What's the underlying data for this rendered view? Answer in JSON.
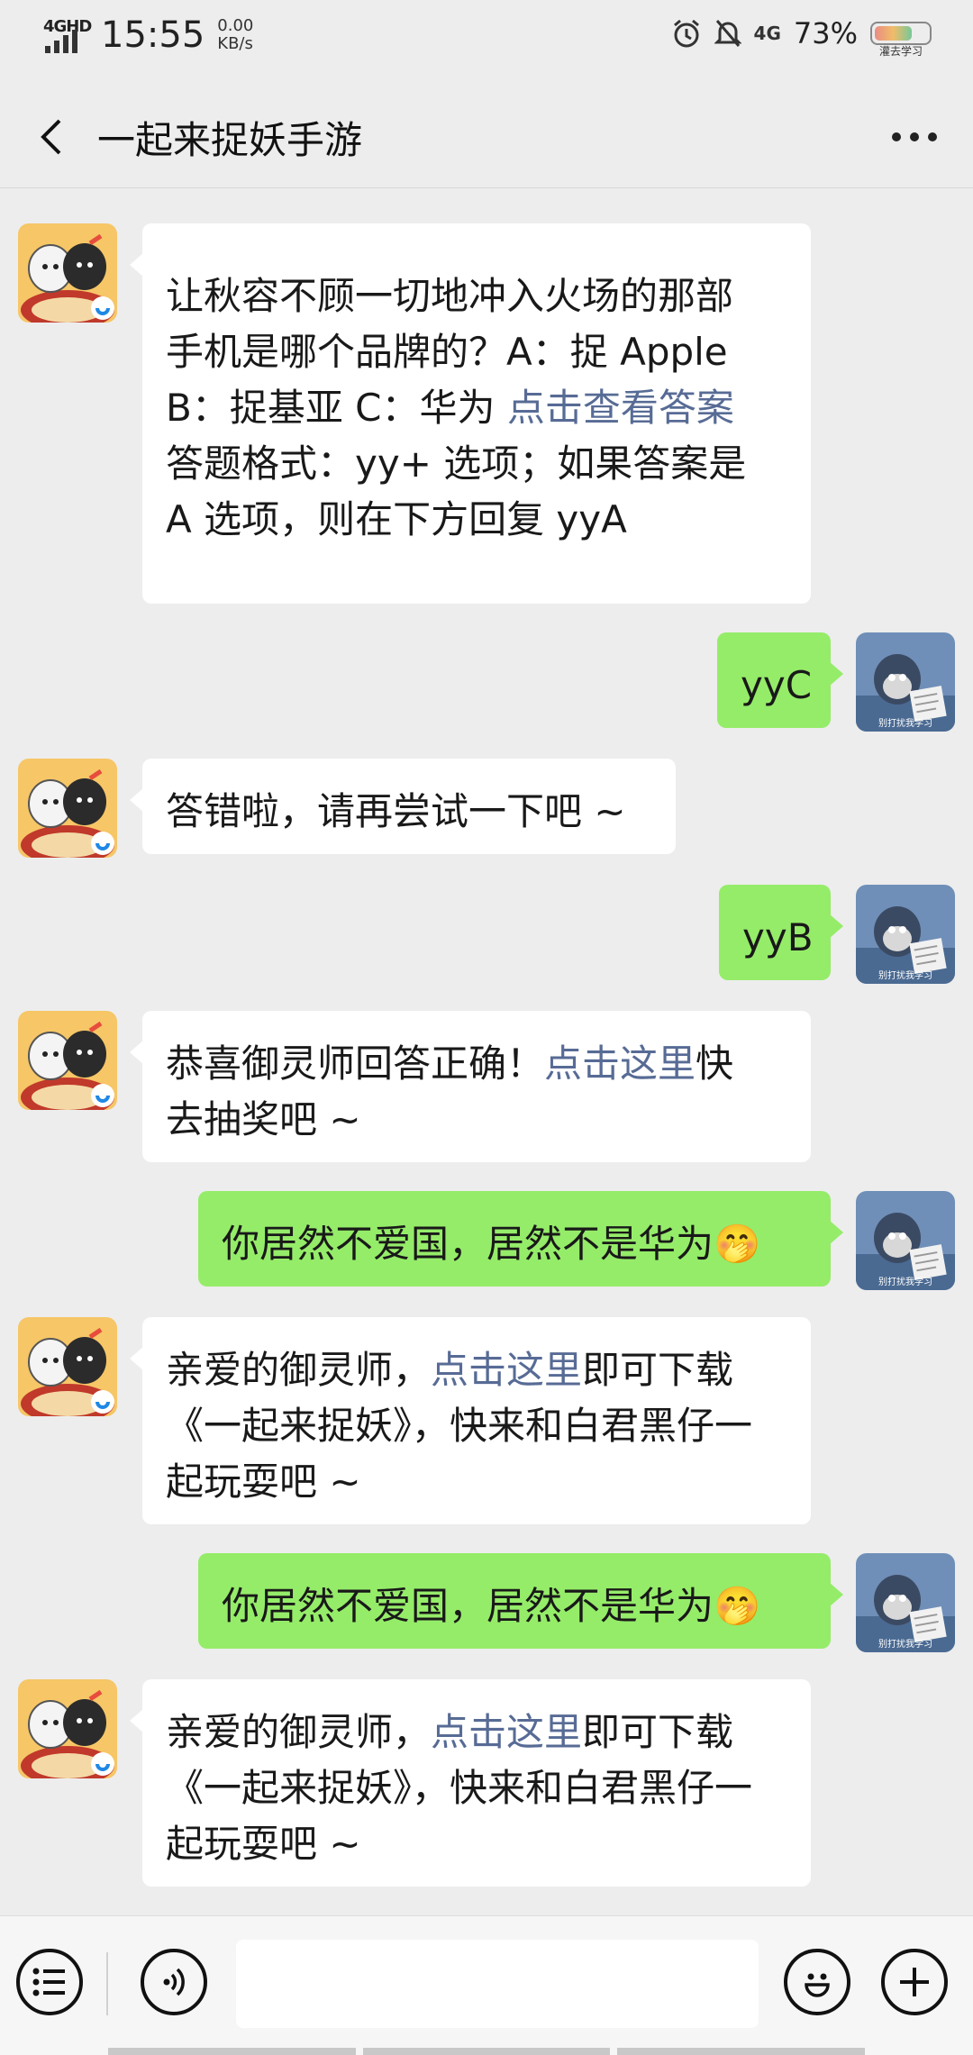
{
  "status_bar": {
    "network_label": "4GHD",
    "time": "15:55",
    "speed_value": "0.00",
    "speed_unit": "KB/s",
    "network_4g": "4G",
    "battery_percent": "73%",
    "battery_caption": "灌去学习"
  },
  "header": {
    "title": "一起来捉妖手游"
  },
  "messages": {
    "m1": {
      "line1": "让秋容不顾一切地冲入火场的那部",
      "line2": "手机是哪个品牌的？A：捉 Apple",
      "line3_prefix": "B：捉基亚 C：华为 ",
      "line3_link": "点击查看答案",
      "line4": "答题格式：yy+ 选项；如果答案是",
      "line5": "A 选项，则在下方回复 yyA"
    },
    "m2": {
      "text": "yyC"
    },
    "m3": {
      "text": "答错啦，请再尝试一下吧 ~"
    },
    "m4": {
      "text": "yyB"
    },
    "m5": {
      "prefix": "恭喜御灵师回答正确！",
      "link": "点击这里",
      "suffix_line1": "快",
      "line2": "去抽奖吧 ~"
    },
    "m6": {
      "text": "你居然不爱国，居然不是华为",
      "emoji": "🤭"
    },
    "m7": {
      "prefix": "亲爱的御灵师，",
      "link": "点击这里",
      "suffix": "即可下载",
      "line2": "《一起来捉妖》，快来和白君黑仔一",
      "line3": "起玩耍吧 ~"
    },
    "m8": {
      "text": "你居然不爱国，居然不是华为",
      "emoji": "🤭"
    },
    "m9": {
      "prefix": "亲爱的御灵师，",
      "link": "点击这里",
      "suffix": "即可下载",
      "line2": "《一起来捉妖》，快来和白君黑仔一",
      "line3": "起玩耍吧 ~"
    }
  },
  "avatars": {
    "bot_caption": "",
    "user_caption": "别打扰我学习"
  },
  "icons": {
    "back": "chevron-left-icon",
    "more": "more-dots-icon",
    "menu": "list-menu-icon",
    "voice": "voice-icon",
    "emoji": "emoji-smile-icon",
    "add": "plus-circle-icon"
  },
  "colors": {
    "outgoing_bubble": "#95ec69",
    "incoming_bubble": "#ffffff",
    "link": "#576b95",
    "background": "#ededed"
  }
}
